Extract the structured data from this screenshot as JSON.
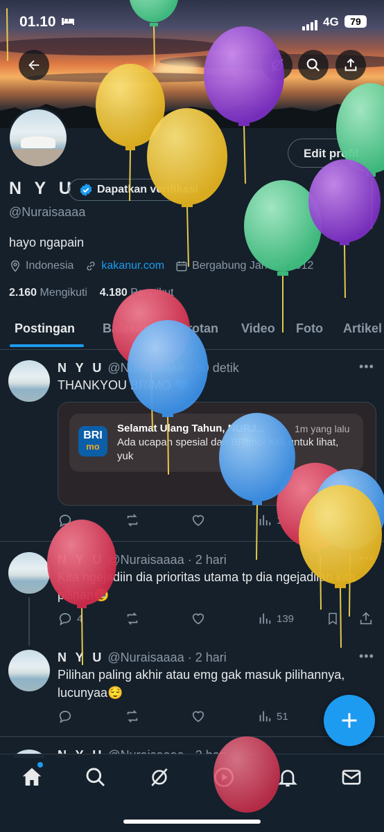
{
  "status": {
    "time": "01.10",
    "network": "4G",
    "battery": "79"
  },
  "profile": {
    "edit_label": "Edit profil",
    "name": "N Y U",
    "verify_label": "Dapatkan verifikasi",
    "handle": "@Nuraisaaaa",
    "bio": "hayo ngapain",
    "location": "Indonesia",
    "website": "kakanur.com",
    "joined": "Bergabung Januari 2012",
    "following_count": "2.160",
    "following_label": "Mengikuti",
    "followers_count": "4.180",
    "followers_label": "Pengikut"
  },
  "tabs": [
    {
      "label": "Postingan"
    },
    {
      "label": "Balasan"
    },
    {
      "label": "Sorotan"
    },
    {
      "label": "Video"
    },
    {
      "label": "Foto"
    },
    {
      "label": "Artikel"
    }
  ],
  "posts": [
    {
      "name": "N Y U",
      "handle": "@Nuraisaaaa",
      "time": "· 50 detik",
      "text": "THANKYOU BRIMO 💙",
      "views": "1",
      "card": {
        "logo": "BRI",
        "logo_sub": "mo",
        "title": "Selamat Ulang Tahun, NURJ...",
        "time": "1m yang lalu",
        "body": "Ada ucapan spesial dari BRImo! Klik untuk lihat, yuk"
      }
    },
    {
      "name": "N Y U",
      "handle": "@Nuraisaaaa",
      "time": "· 2 hari",
      "text": "Kita ngejadiin dia prioritas utama tp dia ngejadiian kita pilihan🥹",
      "replies": "4",
      "views": "139"
    },
    {
      "name": "N Y U",
      "handle": "@Nuraisaaaa",
      "time": "· 2 hari",
      "text": "Pilihan paling akhir atau emg gak masuk pilihannya, lucunyaa😌",
      "views": "51"
    },
    {
      "name": "N Y U",
      "handle": "@Nuraisaaaa",
      "time": "· 2 hari"
    }
  ],
  "colors": {
    "accent": "#1d9bf0",
    "background": "#15202b",
    "muted": "#8b98a5",
    "border": "#38444d"
  },
  "balloons": [
    "green",
    "purple",
    "yellow",
    "yellow",
    "green",
    "green",
    "purple",
    "red",
    "blue",
    "blue",
    "red",
    "blue",
    "yellow",
    "red",
    "red"
  ]
}
